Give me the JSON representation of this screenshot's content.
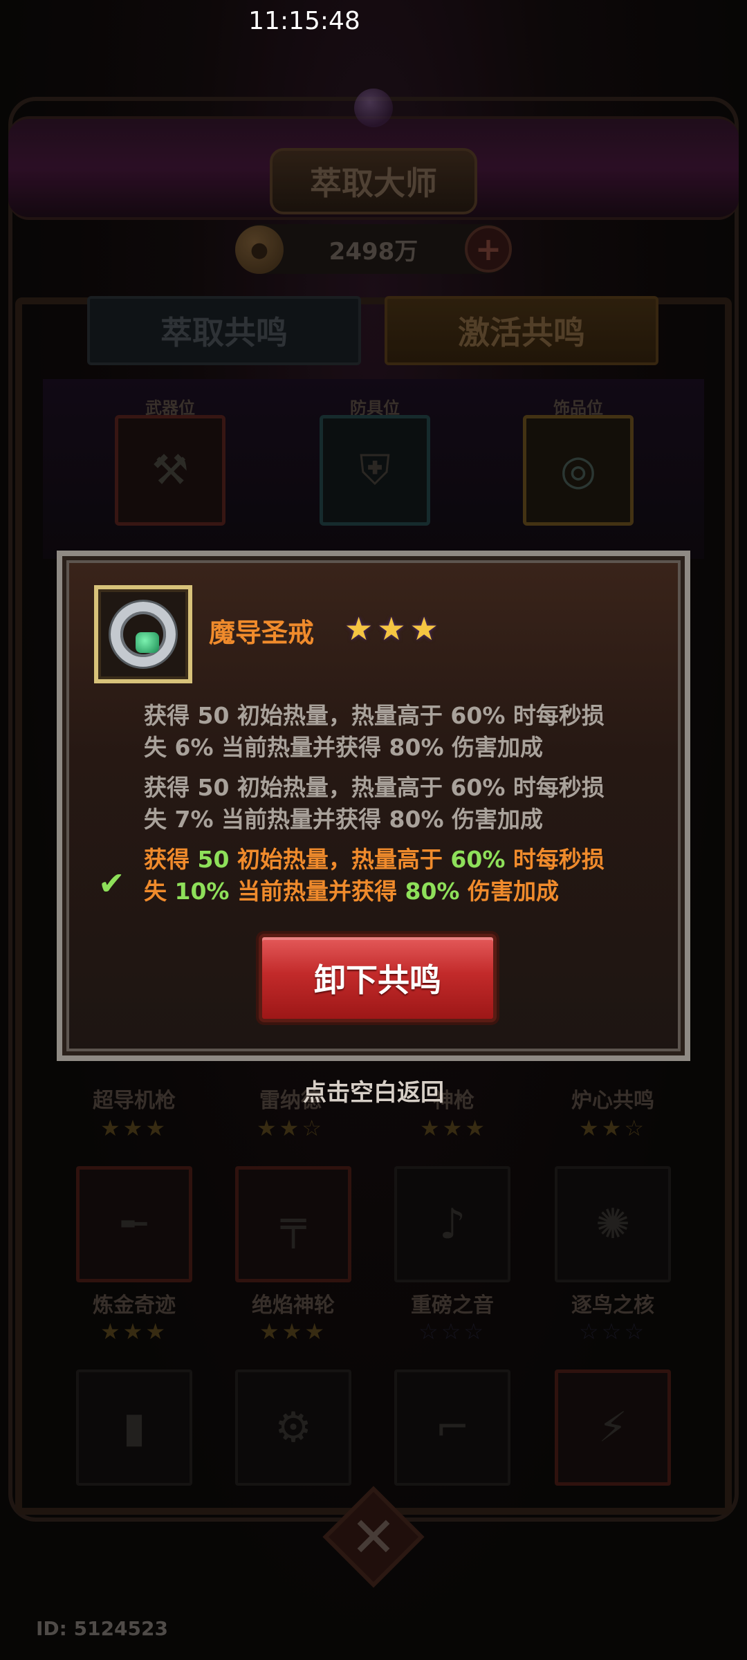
{
  "status_bar": {
    "time": "11:15:48"
  },
  "header": {
    "title": "萃取大师",
    "currency_value": "2498万",
    "plus_label": "+",
    "coin_icon": "coin-icon"
  },
  "tabs": [
    {
      "label": "萃取共鸣",
      "active": false
    },
    {
      "label": "激活共鸣",
      "active": true
    }
  ],
  "slots": [
    {
      "label": "武器位",
      "icon": "cannon-icon",
      "glyph": "⚒"
    },
    {
      "label": "防具位",
      "icon": "armor-icon",
      "glyph": "⛨"
    },
    {
      "label": "饰品位",
      "icon": "ring-icon",
      "glyph": "◎"
    }
  ],
  "grid_rows": [
    {
      "names": [
        "超导机枪",
        "雷纳德",
        "神枪",
        "炉心共鸣"
      ],
      "stars": [
        "★★★",
        "★★☆",
        "★★★",
        "★★☆"
      ]
    },
    {
      "names": [
        "炼金奇迹",
        "绝焰神轮",
        "重磅之音",
        "逐鸟之核"
      ],
      "stars": [
        "★★★",
        "★★★",
        "☆☆☆",
        "☆☆☆"
      ]
    }
  ],
  "popup": {
    "item_name": "魔导圣戒",
    "item_icon": "ring-icon",
    "stars": "★★★",
    "effects": [
      {
        "l1a": "获得 ",
        "n1": "50",
        "l1b": " 初始热量，热量高于 ",
        "n2": "60%",
        "l1c": " 时每秒损",
        "l2a": "失 ",
        "n3": "6%",
        "l2b": " 当前热量并获得 ",
        "n4": "80%",
        "l2c": " 伤害加成",
        "active": false
      },
      {
        "l1a": "获得 ",
        "n1": "50",
        "l1b": " 初始热量，热量高于 ",
        "n2": "60%",
        "l1c": " 时每秒损",
        "l2a": "失 ",
        "n3": "7%",
        "l2b": " 当前热量并获得 ",
        "n4": "80%",
        "l2c": " 伤害加成",
        "active": false
      },
      {
        "l1a": "获得 ",
        "n1": "50",
        "l1b": " 初始热量，热量高于 ",
        "n2": "60%",
        "l1c": " 时每秒损",
        "l2a": "失 ",
        "n3": "10%",
        "l2b": " 当前热量并获得 ",
        "n4": "80%",
        "l2c": " 伤害加成",
        "active": true
      }
    ],
    "check_glyph": "✔",
    "unequip_label": "卸下共鸣"
  },
  "hint": "点击空白返回",
  "close_glyph": "✕",
  "player_id": "ID: 5124523",
  "colors": {
    "active_text": "#f08b2c",
    "number_highlight": "#8ee05a",
    "button_red": "#c22a2a",
    "star_gold": "#f5c542"
  }
}
